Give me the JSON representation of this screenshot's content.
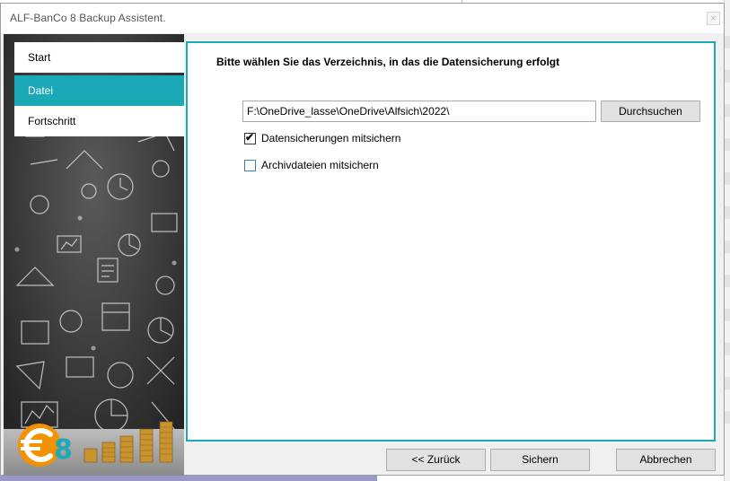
{
  "window": {
    "title": "ALF-BanCo 8 Backup Assistent.",
    "close_symbol": "×"
  },
  "sidebar": {
    "items": [
      {
        "label": "Start",
        "active": false
      },
      {
        "label": "Datei",
        "active": true
      },
      {
        "label": "Fortschritt",
        "active": false
      }
    ],
    "logo_text": "€8"
  },
  "main": {
    "heading": "Bitte wählen Sie das Verzeichnis, in das die Datensicherung erfolgt",
    "path_value": "F:\\OneDrive_lasse\\OneDrive\\Alfsich\\2022\\",
    "browse_label": "Durchsuchen",
    "options": [
      {
        "label": "Datensicherungen mitsichern",
        "checked": true
      },
      {
        "label": "Archivdateien mitsichern",
        "checked": false
      }
    ]
  },
  "footer": {
    "back_label": "<< Zurück",
    "save_label": "Sichern",
    "cancel_label": "Abbrechen"
  },
  "colors": {
    "accent": "#1ba8b7",
    "logo_orange": "#f39200",
    "logo_teal": "#1ba8b7",
    "sidebar_dark": "#2f2f2f"
  },
  "icons": [
    "checkmark-icon",
    "close-icon",
    "euro-8-logo-icon"
  ]
}
